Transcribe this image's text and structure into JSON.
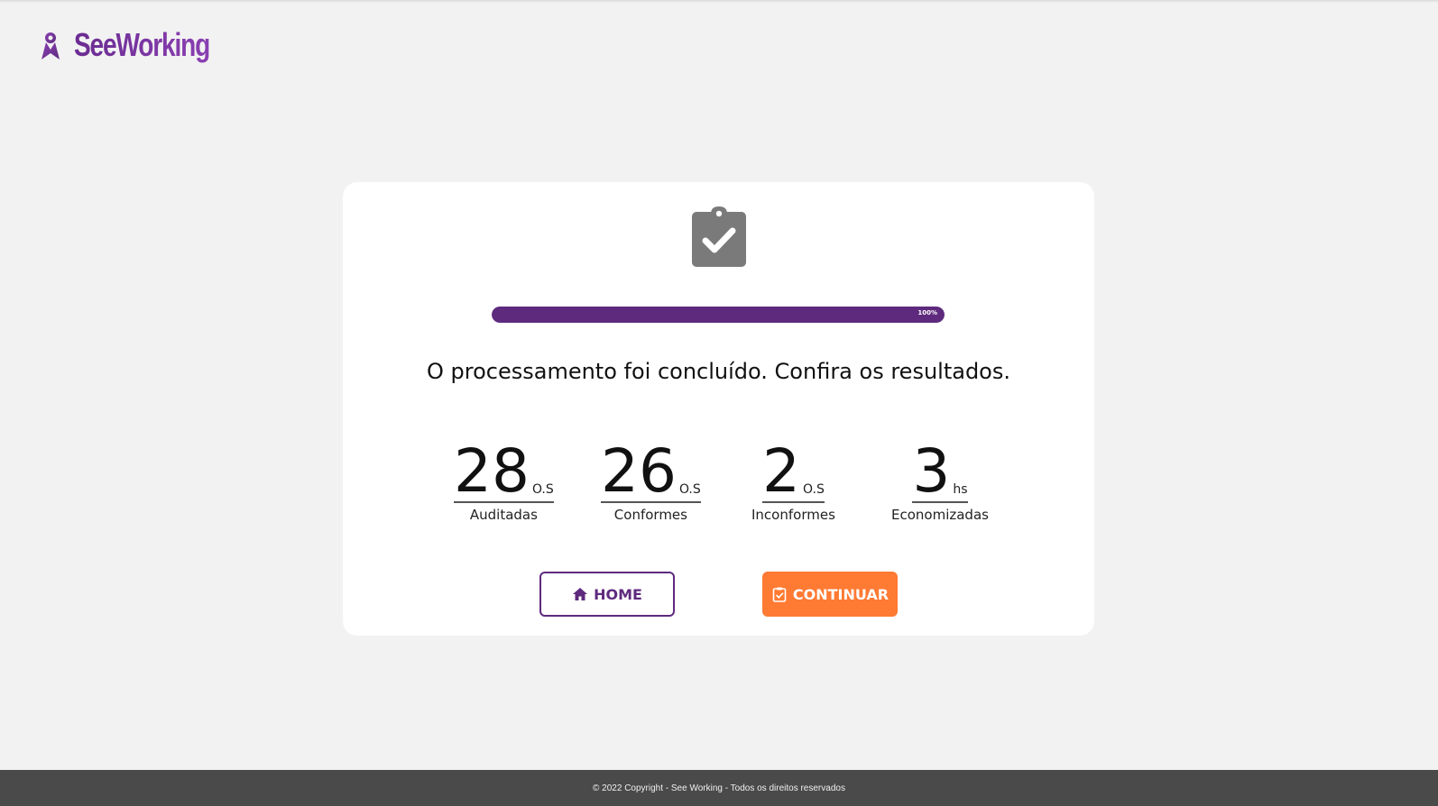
{
  "header": {
    "logo_text": "SeeWorking",
    "brand_color": "#5e2a7e"
  },
  "card": {
    "icon": "clipboard-check-icon",
    "progress": {
      "percent": 100,
      "label": "100%",
      "color": "#5e2a7e"
    },
    "message": "O processamento foi concluído. Confira os resultados.",
    "stats": [
      {
        "value": "28",
        "unit": "O.S",
        "label": "Auditadas"
      },
      {
        "value": "26",
        "unit": "O.S",
        "label": "Conformes"
      },
      {
        "value": "2",
        "unit": "O.S",
        "label": "Inconformes"
      },
      {
        "value": "3",
        "unit": "hs",
        "label": "Economizadas"
      }
    ],
    "buttons": {
      "home": {
        "label": "HOME",
        "icon": "home-icon"
      },
      "continue": {
        "label": "CONTINUAR",
        "icon": "clipboard-check-icon",
        "color": "#ff7a33"
      }
    }
  },
  "footer": {
    "text": "© 2022 Copyright - See Working - Todos os direitos reservados"
  }
}
